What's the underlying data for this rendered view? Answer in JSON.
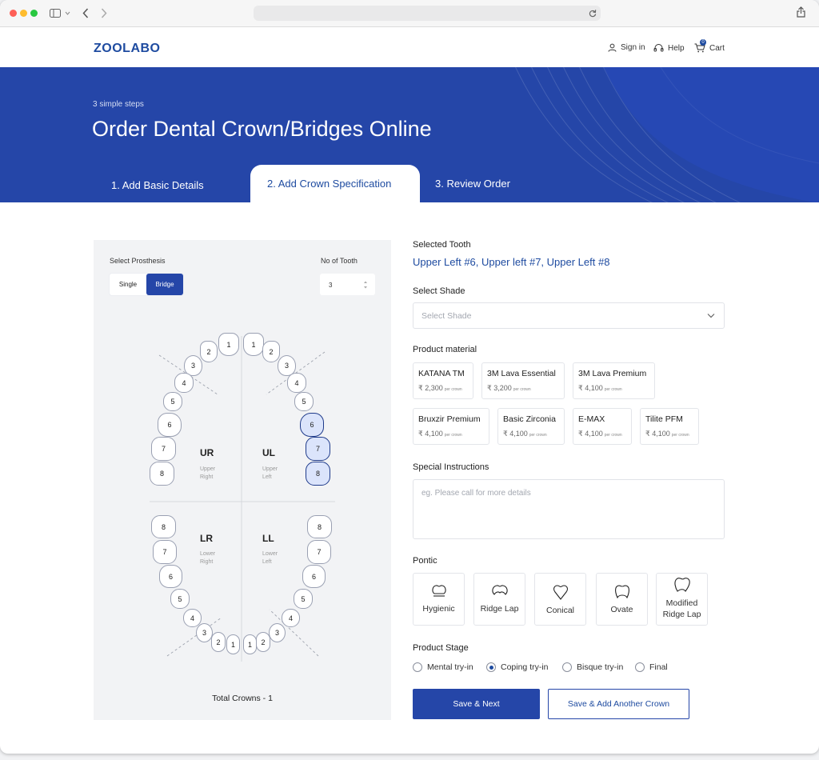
{
  "browser": {
    "url": ""
  },
  "header": {
    "logo": "ZOOLABO",
    "sign_in": "Sign in",
    "help": "Help",
    "cart": "Cart",
    "cart_count": "0"
  },
  "hero": {
    "subtitle": "3 simple steps",
    "title": "Order Dental Crown/Bridges Online",
    "tabs": [
      {
        "label": "1. Add Basic Details"
      },
      {
        "label": "2. Add Crown Specification"
      },
      {
        "label": "3. Review Order"
      }
    ]
  },
  "left": {
    "prosthesis_label": "Select Prosthesis",
    "prosthesis_options": [
      "Single",
      "Bridge"
    ],
    "prosthesis_selected": "Bridge",
    "tooth_count_label": "No of Tooth",
    "tooth_count_value": "3",
    "quadrants": [
      {
        "code": "UR",
        "line1": "Upper",
        "line2": "Right"
      },
      {
        "code": "UL",
        "line1": "Upper",
        "line2": "Left"
      },
      {
        "code": "LR",
        "line1": "Lower",
        "line2": "Right"
      },
      {
        "code": "LL",
        "line1": "Lower",
        "line2": "Left"
      }
    ],
    "selected_teeth": [
      "UL6",
      "UL7",
      "UL8"
    ],
    "total_crowns": "Total Crowns - 1"
  },
  "right": {
    "selected_tooth_label": "Selected Tooth",
    "selected_tooth_value": "Upper Left #6, Upper left #7, Upper Left #8",
    "shade_label": "Select Shade",
    "shade_placeholder": "Select Shade",
    "material_label": "Product material",
    "materials": [
      {
        "name": "KATANA TM",
        "price": "₹ 2,300",
        "unit": "per crown"
      },
      {
        "name": "3M Lava Essential",
        "price": "₹ 3,200",
        "unit": "per crown"
      },
      {
        "name": "3M Lava Premium",
        "price": "₹ 4,100",
        "unit": "per crown"
      },
      {
        "name": "Bruxzir Premium",
        "price": "₹ 4,100",
        "unit": "per crown"
      },
      {
        "name": "Basic Zirconia",
        "price": "₹ 4,100",
        "unit": "per crown"
      },
      {
        "name": "E-MAX",
        "price": "₹ 4,100",
        "unit": "per crown"
      },
      {
        "name": "Tilite PFM",
        "price": "₹ 4,100",
        "unit": "per crown"
      }
    ],
    "instructions_label": "Special Instructions",
    "instructions_placeholder": "eg. Please call for more details",
    "pontic_label": "Pontic",
    "pontics": [
      {
        "line1": "Hygienic",
        "line2": ""
      },
      {
        "line1": "Ridge Lap",
        "line2": ""
      },
      {
        "line1": "Conical",
        "line2": ""
      },
      {
        "line1": "Ovate",
        "line2": ""
      },
      {
        "line1": "Modified",
        "line2": "Ridge Lap"
      }
    ],
    "stage_label": "Product Stage",
    "stages": [
      "Mental try-in",
      "Coping try-in",
      "Bisque try-in",
      "Final"
    ],
    "stage_selected": "Coping try-in",
    "save_next": "Save & Next",
    "save_add": "Save & Add Another Crown"
  },
  "colors": {
    "brand": "#2546a8",
    "accent": "#1e4ba0",
    "selected_tooth": "#dbe4fb"
  }
}
